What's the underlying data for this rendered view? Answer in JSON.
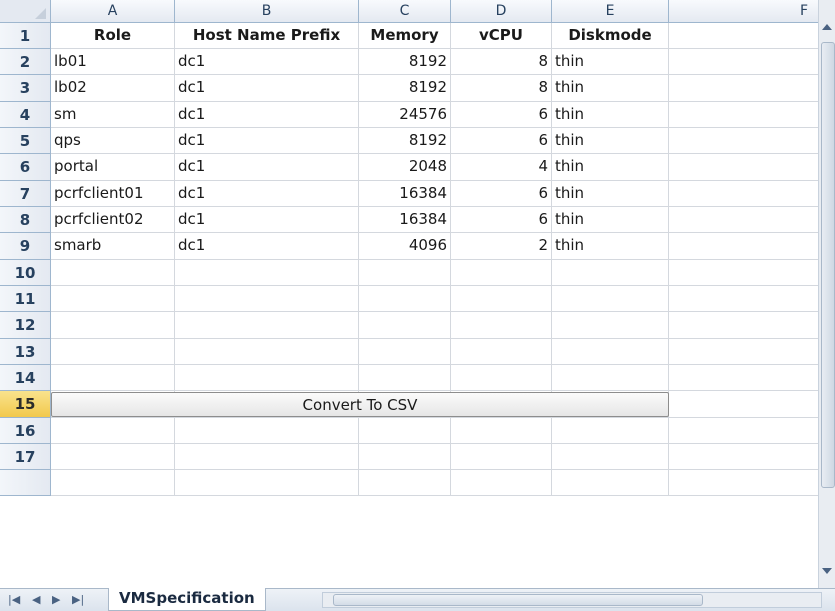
{
  "columns": [
    "A",
    "B",
    "C",
    "D",
    "E",
    "F"
  ],
  "row_numbers": [
    "1",
    "2",
    "3",
    "4",
    "5",
    "6",
    "7",
    "8",
    "9",
    "10",
    "11",
    "12",
    "13",
    "14",
    "15",
    "16",
    "17"
  ],
  "header_row": {
    "role": "Role",
    "host": "Host Name Prefix",
    "memory": "Memory",
    "vcpu": "vCPU",
    "diskmode": "Diskmode"
  },
  "rows": [
    {
      "role": "lb01",
      "host": "dc1",
      "memory": "8192",
      "vcpu": "8",
      "diskmode": "thin"
    },
    {
      "role": "lb02",
      "host": "dc1",
      "memory": "8192",
      "vcpu": "8",
      "diskmode": "thin"
    },
    {
      "role": "sm",
      "host": "dc1",
      "memory": "24576",
      "vcpu": "6",
      "diskmode": "thin"
    },
    {
      "role": "qps",
      "host": "dc1",
      "memory": "8192",
      "vcpu": "6",
      "diskmode": "thin"
    },
    {
      "role": "portal",
      "host": "dc1",
      "memory": "2048",
      "vcpu": "4",
      "diskmode": "thin"
    },
    {
      "role": "pcrfclient01",
      "host": "dc1",
      "memory": "16384",
      "vcpu": "6",
      "diskmode": "thin"
    },
    {
      "role": "pcrfclient02",
      "host": "dc1",
      "memory": "16384",
      "vcpu": "6",
      "diskmode": "thin"
    },
    {
      "role": "smarb",
      "host": "dc1",
      "memory": "4096",
      "vcpu": "2",
      "diskmode": "thin"
    }
  ],
  "active_row": "15",
  "convert_button": {
    "label": "Convert To CSV"
  },
  "sheet_tab": {
    "label": "VMSpecification"
  },
  "icons": {
    "select_all": "select-all-triangle",
    "nav_first": "first-sheet-icon",
    "nav_prev": "prev-sheet-icon",
    "nav_next": "next-sheet-icon",
    "nav_last": "last-sheet-icon"
  },
  "colors": {
    "header_bg": "#e4e9f1",
    "active_row_header": "#f2c94c",
    "gridline": "#d4d8de"
  }
}
